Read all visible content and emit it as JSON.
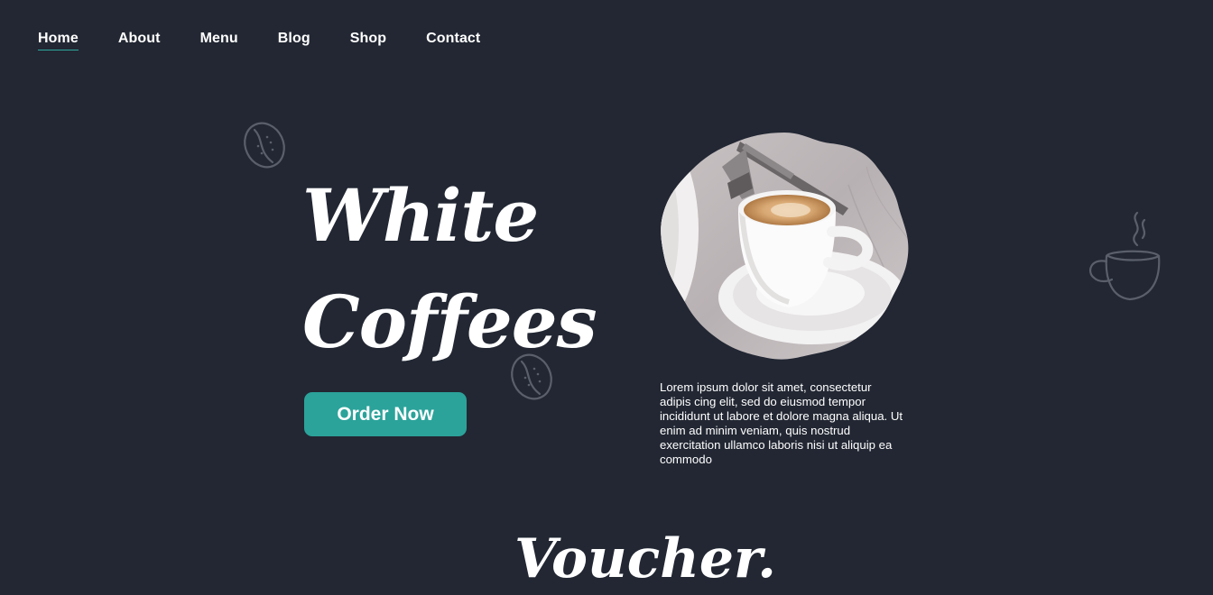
{
  "nav": {
    "items": [
      {
        "label": "Home",
        "active": true
      },
      {
        "label": "About",
        "active": false
      },
      {
        "label": "Menu",
        "active": false
      },
      {
        "label": "Blog",
        "active": false
      },
      {
        "label": "Shop",
        "active": false
      },
      {
        "label": "Contact",
        "active": false
      }
    ]
  },
  "hero": {
    "title_line1": "White",
    "title_line2": "Coffees",
    "order_button_label": "Order Now",
    "description": "Lorem ipsum dolor sit amet, consectetur adipis cing elit, sed do eiusmod tempor incididunt ut labore et dolore magna aliqua. Ut enim ad minim veniam, quis nostrud exercitation ullamco laboris nisi ut aliquip ea commodo"
  },
  "voucher": {
    "title": "Voucher."
  },
  "icons": {
    "bean_top": "coffee-bean-icon",
    "bean_bottom": "coffee-bean-icon",
    "cup": "coffee-cup-icon"
  },
  "colors": {
    "background": "#222733",
    "accent": "#2ba39a",
    "text": "#ffffff",
    "icon_stroke": "#5a5f6b"
  }
}
